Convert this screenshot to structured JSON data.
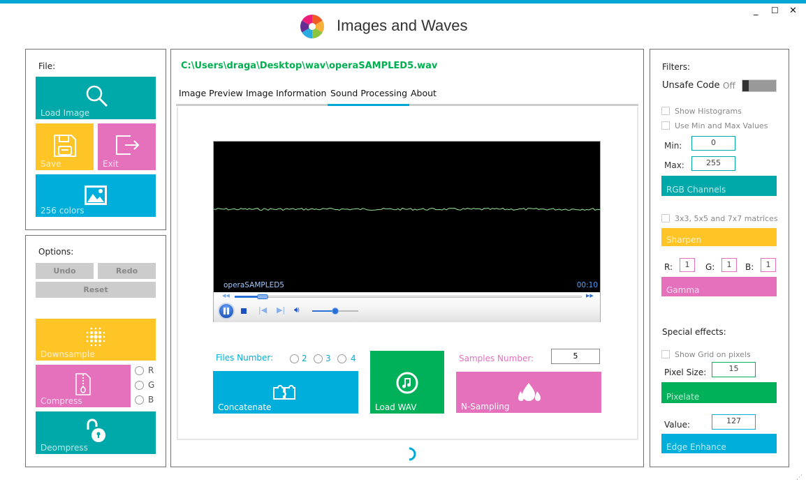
{
  "window": {
    "title": "Images and Waves",
    "minimize": "_",
    "maximize": "☐",
    "close": "✕"
  },
  "left": {
    "file_label": "File:",
    "load_image": "Load Image",
    "save": "Save",
    "exit": "Exit",
    "colors256": "256 colors",
    "options_label": "Options:",
    "undo": "Undo",
    "redo": "Redo",
    "reset": "Reset",
    "downsample": "Downsample",
    "compress": "Compress",
    "decompress": "Deompress",
    "channels": [
      "R",
      "G",
      "B"
    ]
  },
  "center": {
    "path": "C:\\Users\\draga\\Desktop\\wav\\operaSAMPLED5.wav",
    "tabs": [
      "Image Preview",
      "Image Information",
      "Sound Processing",
      "About"
    ],
    "active_tab": "Sound Processing",
    "player": {
      "track": "operaSAMPLED5",
      "time": "00:10",
      "seek_progress": 0.08,
      "volume": 0.5,
      "state": "playing"
    },
    "files_number_label": "Files Number:",
    "files_options": [
      "2",
      "3",
      "4"
    ],
    "concatenate": "Concatenate",
    "load_wav": "Load WAV",
    "samples_label": "Samples Number:",
    "samples_value": "5",
    "n_sampling": "N-Sampling"
  },
  "right": {
    "filters_label": "Filters:",
    "unsafe_code": "Unsafe Code",
    "unsafe_state": "Off",
    "show_histograms": "Show Histograms",
    "use_min_max": "Use Min and Max Values",
    "min_label": "Min:",
    "min_value": "0",
    "max_label": "Max:",
    "max_value": "255",
    "rgb_channels": "RGB Channels",
    "matrices": "3x3, 5x5 and 7x7 matrices",
    "sharpen": "Sharpen",
    "r_label": "R:",
    "r_value": "1",
    "g_label": "G:",
    "g_value": "1",
    "b_label": "B:",
    "b_value": "1",
    "gamma": "Gamma",
    "special_label": "Special effects:",
    "show_grid": "Show Grid on pixels",
    "pixel_size_label": "Pixel Size:",
    "pixel_size_value": "15",
    "pixelate": "Pixelate",
    "value_label": "Value:",
    "value_value": "127",
    "edge_enhance": "Edge Enhance"
  },
  "colors": {
    "teal": "#00a9a9",
    "yellow": "#ffc425",
    "pink": "#e571bd",
    "blue": "#00aedb",
    "green": "#00b159",
    "path_green": "#00b050",
    "accent": "#00a8d8"
  }
}
